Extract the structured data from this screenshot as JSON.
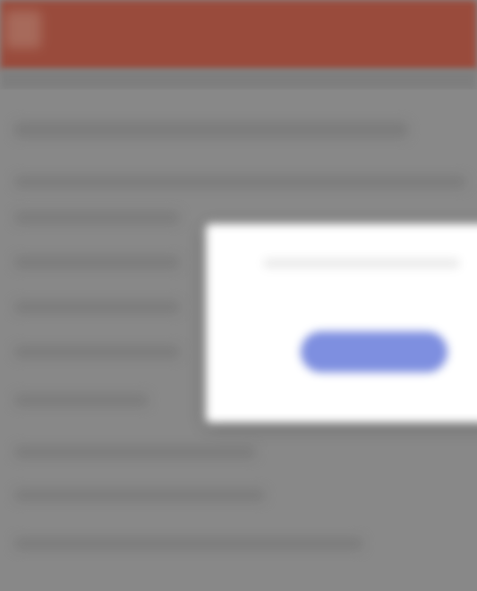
{
  "app_bar": {
    "color": "#a23a26",
    "icon": "app-logo-icon"
  },
  "dialog": {
    "message": "",
    "button_label": "",
    "button_color": "#7e8fe0"
  },
  "note": ""
}
